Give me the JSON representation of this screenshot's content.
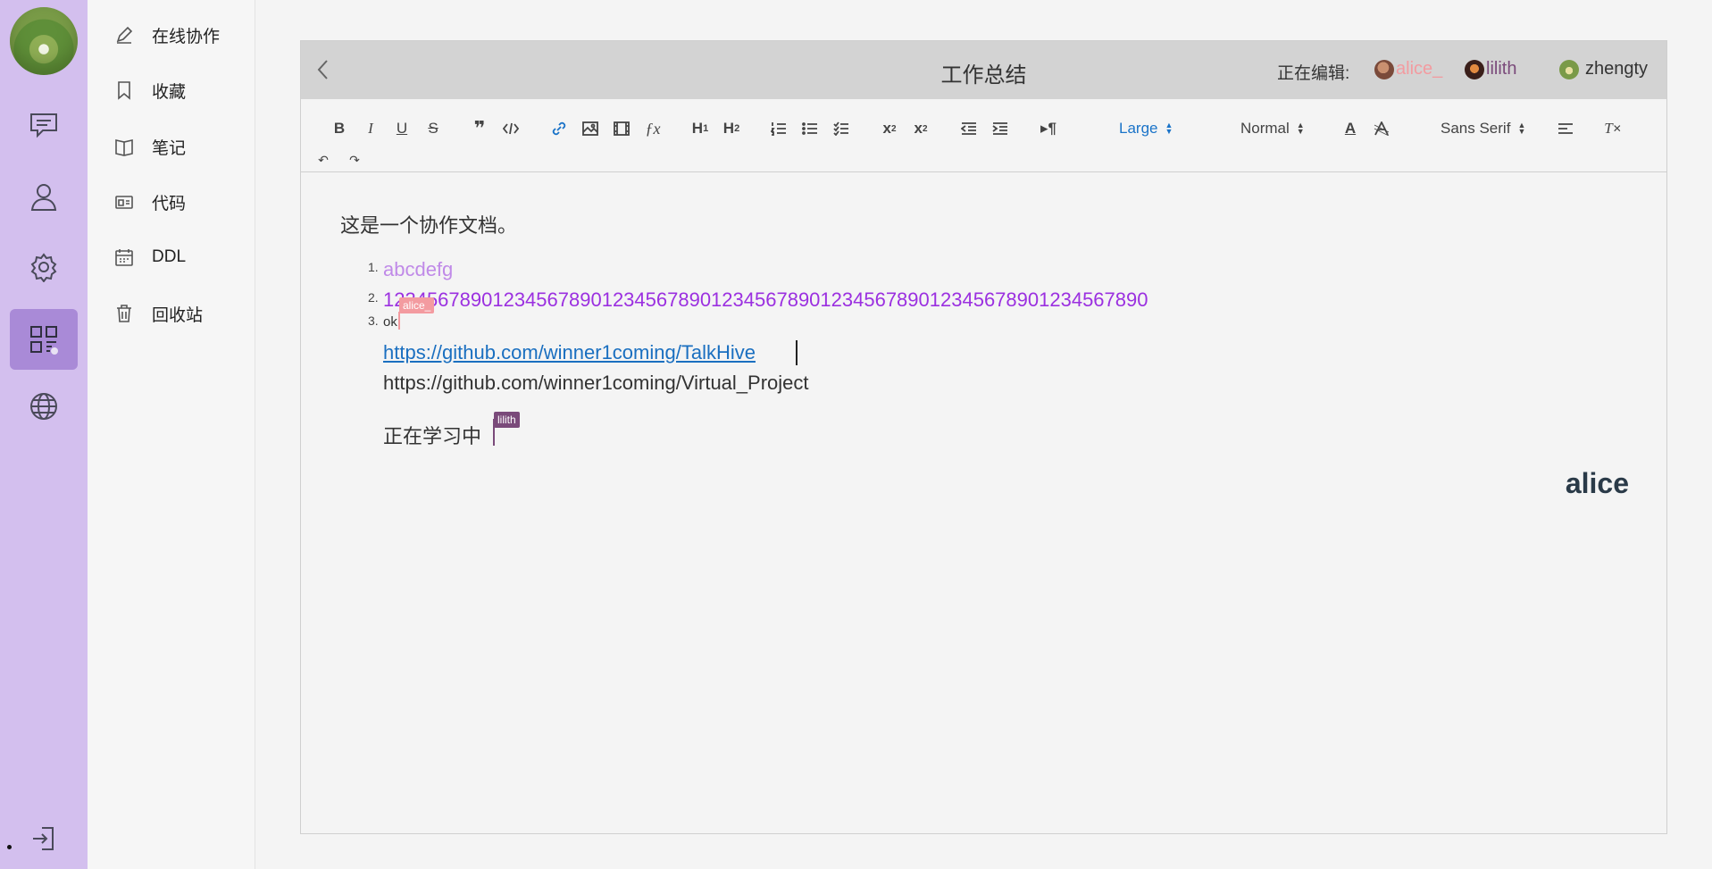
{
  "nav": {
    "rail_icons": [
      "chat-icon",
      "user-icon",
      "gear-icon",
      "apps-icon",
      "globe-icon",
      "logout-icon"
    ],
    "menu": [
      {
        "label": "在线协作",
        "icon": "pencil-icon"
      },
      {
        "label": "收藏",
        "icon": "bookmark-icon"
      },
      {
        "label": "笔记",
        "icon": "notebook-icon"
      },
      {
        "label": "代码",
        "icon": "code-card-icon"
      },
      {
        "label": "DDL",
        "icon": "calendar-icon"
      },
      {
        "label": "回收站",
        "icon": "trash-icon"
      }
    ]
  },
  "editor": {
    "title": "工作总结",
    "editing_label": "正在编辑:",
    "users": [
      {
        "name": "alice_",
        "color": "#f39ba0"
      },
      {
        "name": "lilith",
        "color": "#7a4a7a"
      },
      {
        "name": "zhengty",
        "color": "#333333"
      }
    ],
    "toolbar": {
      "size_select": "Large",
      "heading_select": "Normal",
      "font_select": "Sans Serif"
    },
    "content": {
      "intro": "这是一个协作文档。",
      "list": [
        {
          "num": "1.",
          "text": "abcdefg",
          "color": "#c08ae8"
        },
        {
          "num": "2.",
          "text": "1234567890123456789012345678901234567890123456789012345678901234567890",
          "color": "#9b30e0"
        },
        {
          "num": "3.",
          "text": "ok",
          "color": "#333333"
        }
      ],
      "link1": "https://github.com/winner1coming/TalkHive",
      "link2": "https://github.com/winner1coming/Virtual_Project",
      "studying": "正在学习中",
      "signature": "alice",
      "cursor_alice": "alice_",
      "cursor_lilith": "lilith"
    }
  }
}
